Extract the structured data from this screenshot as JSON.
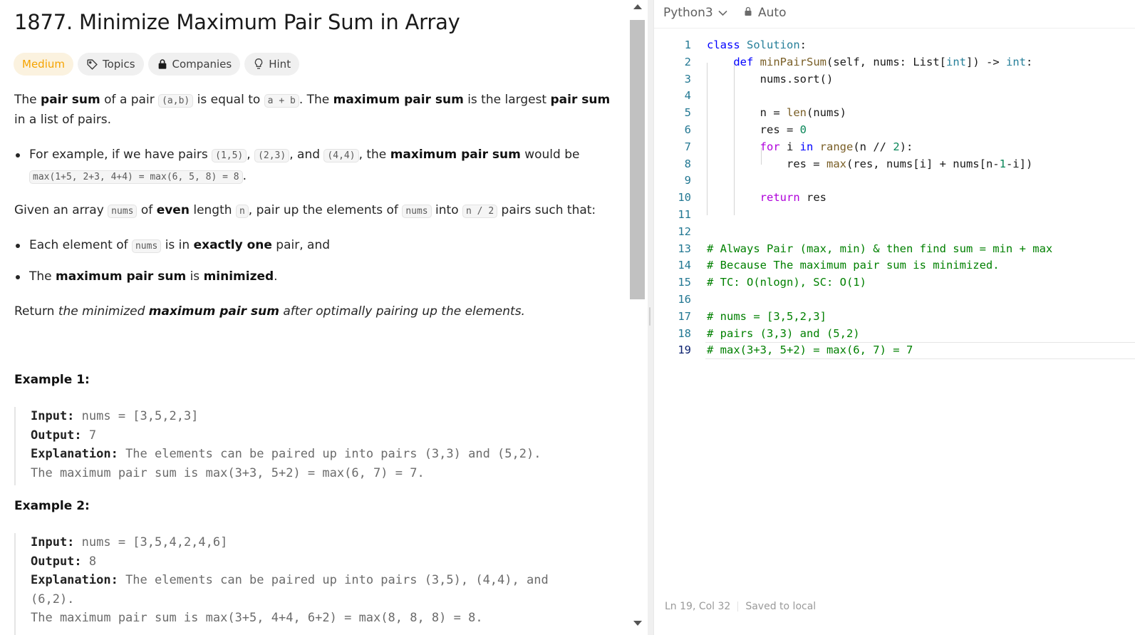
{
  "problem": {
    "title": "1877. Minimize Maximum Pair Sum in Array",
    "difficulty": "Medium",
    "tags": {
      "topics": "Topics",
      "companies": "Companies",
      "hint": "Hint"
    },
    "para1": {
      "t1": "The ",
      "b1": "pair sum",
      "t2": " of a pair ",
      "c1": "(a,b)",
      "t3": " is equal to ",
      "c2": "a + b",
      "t4": ". The ",
      "b2": "maximum pair sum",
      "t5": " is the largest ",
      "b3": "pair sum",
      "t6": " in a list of pairs."
    },
    "bullet1": {
      "t1": "For example, if we have pairs ",
      "c1": "(1,5)",
      "t2": ", ",
      "c2": "(2,3)",
      "t3": ", and ",
      "c3": "(4,4)",
      "t4": ", the ",
      "b1": "maximum pair sum",
      "t5": " would be ",
      "c4": "max(1+5, 2+3, 4+4) = max(6, 5, 8) = 8",
      "t6": "."
    },
    "para2": {
      "t1": "Given an array ",
      "c1": "nums",
      "t2": " of ",
      "b1": "even",
      "t3": " length ",
      "c2": "n",
      "t4": ", pair up the elements of ",
      "c3": "nums",
      "t5": " into ",
      "c4": "n / 2",
      "t6": " pairs such that:"
    },
    "bullet2": {
      "t1": "Each element of ",
      "c1": "nums",
      "t2": " is in ",
      "b1": "exactly one",
      "t3": " pair, and"
    },
    "bullet3": {
      "t1": "The ",
      "b1": "maximum pair sum",
      "t2": " is ",
      "b2": "minimized",
      "t3": "."
    },
    "para3": {
      "t1": "Return ",
      "i1": "the minimized ",
      "b1": "maximum pair sum",
      "i2": " after optimally pairing up the elements."
    },
    "examples": [
      {
        "heading": "Example 1:",
        "input_label": "Input:",
        "input": " nums = [3,5,2,3]",
        "output_label": "Output:",
        "output": " 7",
        "expl_label": "Explanation:",
        "expl1": " The elements can be paired up into pairs (3,3) and (5,2).",
        "expl2": "The maximum pair sum is max(3+3, 5+2) = max(6, 7) = 7."
      },
      {
        "heading": "Example 2:",
        "input_label": "Input:",
        "input": " nums = [3,5,4,2,4,6]",
        "output_label": "Output:",
        "output": " 8",
        "expl_label": "Explanation:",
        "expl1": " The elements can be paired up into pairs (3,5), (4,4), and",
        "expl1b": "(6,2).",
        "expl2": "The maximum pair sum is max(3+5, 4+4, 6+2) = max(8, 8, 8) = 8."
      }
    ]
  },
  "editor": {
    "language": "Python3",
    "mode": "Auto",
    "line_numbers": [
      "1",
      "2",
      "3",
      "4",
      "5",
      "6",
      "7",
      "8",
      "9",
      "10",
      "11",
      "12",
      "13",
      "14",
      "15",
      "16",
      "17",
      "18",
      "19"
    ],
    "code": {
      "l1": {
        "a": "class",
        "b": " ",
        "c": "Solution",
        "d": ":"
      },
      "l2": {
        "a": "    ",
        "b": "def",
        "c": " ",
        "d": "minPairSum",
        "e": "(self, nums: ",
        "f": "List",
        "g": "[",
        "h": "int",
        "i": "]) -> ",
        "j": "int",
        "k": ":"
      },
      "l3": "        nums.sort()",
      "l5": {
        "a": "        n = ",
        "b": "len",
        "c": "(nums)"
      },
      "l6": {
        "a": "        res = ",
        "b": "0"
      },
      "l7": {
        "a": "        ",
        "b": "for",
        "c": " i ",
        "d": "in",
        "e": " ",
        "f": "range",
        "g": "(n // ",
        "h": "2",
        "i": "):"
      },
      "l8": {
        "a": "            res = ",
        "b": "max",
        "c": "(res, nums[i] + nums[n-",
        "d": "1",
        "e": "-i])"
      },
      "l10": {
        "a": "        ",
        "b": "return",
        "c": " res"
      },
      "l13": "# Always Pair (max, min) & then find sum = min + max",
      "l14": "# Because The maximum pair sum is minimized.",
      "l15": "# TC: O(nlogn), SC: O(1)",
      "l17": "# nums = [3,5,2,3]",
      "l18": "# pairs (3,3) and (5,2)",
      "l19": "# max(3+3, 5+2) = max(6, 7) = 7"
    }
  },
  "status": {
    "position": "Ln 19, Col 32",
    "saved": "Saved to local"
  },
  "colors": {
    "difficulty": "#f5a300",
    "keyword": "#0000ff",
    "comment": "#008000",
    "line_number": "#237893"
  },
  "icons": [
    "tag-icon",
    "lock-icon",
    "lightbulb-icon",
    "chevron-down-icon",
    "scroll-up-icon",
    "scroll-down-icon"
  ]
}
